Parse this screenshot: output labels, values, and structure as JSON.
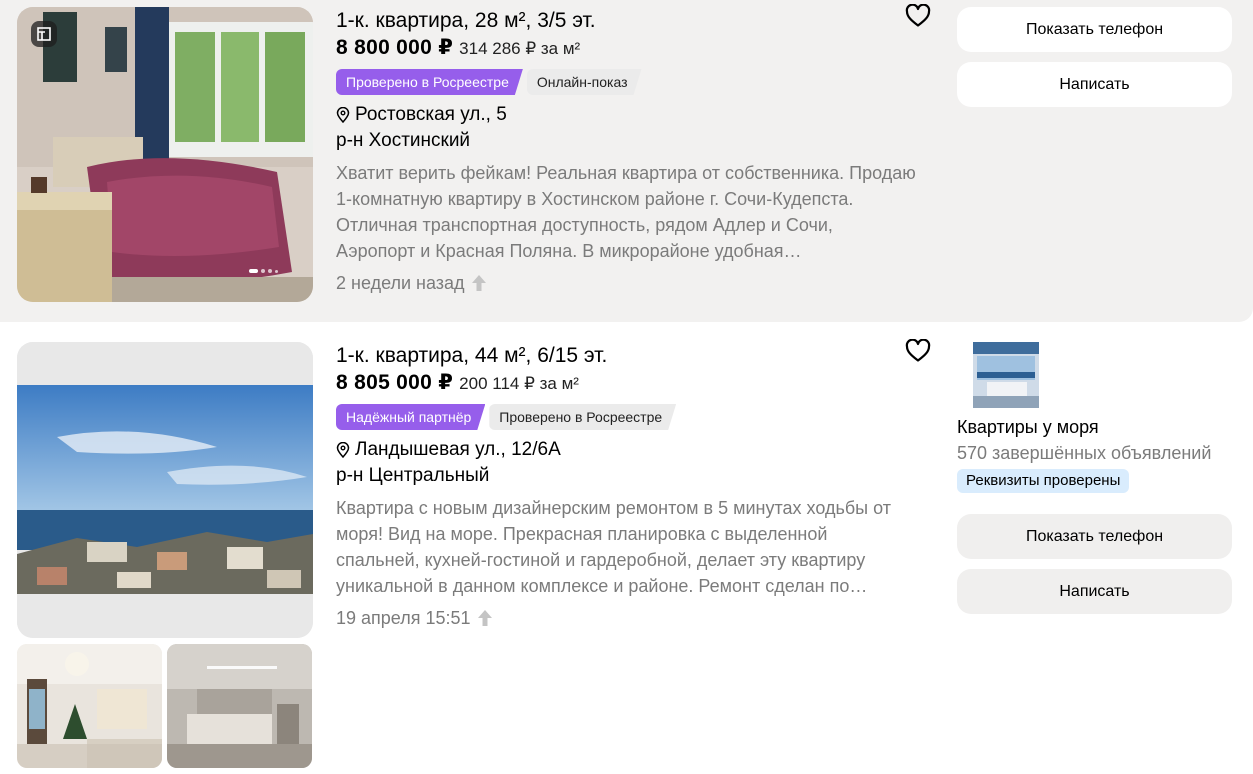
{
  "listings": [
    {
      "title": "1-к. квартира, 28 м², 3/5 эт.",
      "price": "8 800 000 ₽",
      "price_per_m2": "314 286 ₽ за м²",
      "tags": [
        {
          "label": "Проверено в Росреестре",
          "style": "purple"
        },
        {
          "label": "Онлайн-показ",
          "style": "grey"
        }
      ],
      "address": "Ростовская ул., 5",
      "district": "р-н Хостинский",
      "description": "Хватит верить фейкам! Реальная квартира от собственника. Продаю 1-комнатную квартиру в Хостинском районе г. Сочи-Кудепста. Отличная транспортная доступность, рядом Адлер и Сочи, Аэропорт и Красная Поляна. В микрорайоне удобная…",
      "date": "2 недели назад",
      "buttons": {
        "phone": "Показать телефон",
        "write": "Написать"
      },
      "photo_count_dots": 4
    },
    {
      "title": "1-к. квартира, 44 м², 6/15 эт.",
      "price": "8 805 000 ₽",
      "price_per_m2": "200 114 ₽ за м²",
      "tags": [
        {
          "label": "Надёжный партнёр",
          "style": "purple"
        },
        {
          "label": "Проверено в Росреестре",
          "style": "grey"
        }
      ],
      "address": "Ландышевая ул., 12/6А",
      "district": "р-н Центральный",
      "description": "Квартира с новым дизайнерским ремонтом в 5 минутах ходьбы от моря! Вид на море. Прекрасная планировка с выделенной спальней, кухней-гостиной и гардеробной, делает эту квартиру уникальной в данном комплексе и районе. Ремонт сделан по…",
      "date": "19 апреля 15:51",
      "seller": {
        "name": "Квартиры у моря",
        "completed": "570 завершённых объявлений",
        "badge": "Реквизиты проверены"
      },
      "buttons": {
        "phone": "Показать телефон",
        "write": "Написать"
      }
    }
  ],
  "colors": {
    "accent_purple": "#965eeb",
    "badge_blue": "#d9ecfd",
    "muted_text": "#7b7b7b",
    "card_bg": "#f2f1f0"
  },
  "icons": [
    "floor-plan-icon",
    "heart-icon",
    "location-pin-icon",
    "raise-arrow-icon"
  ]
}
